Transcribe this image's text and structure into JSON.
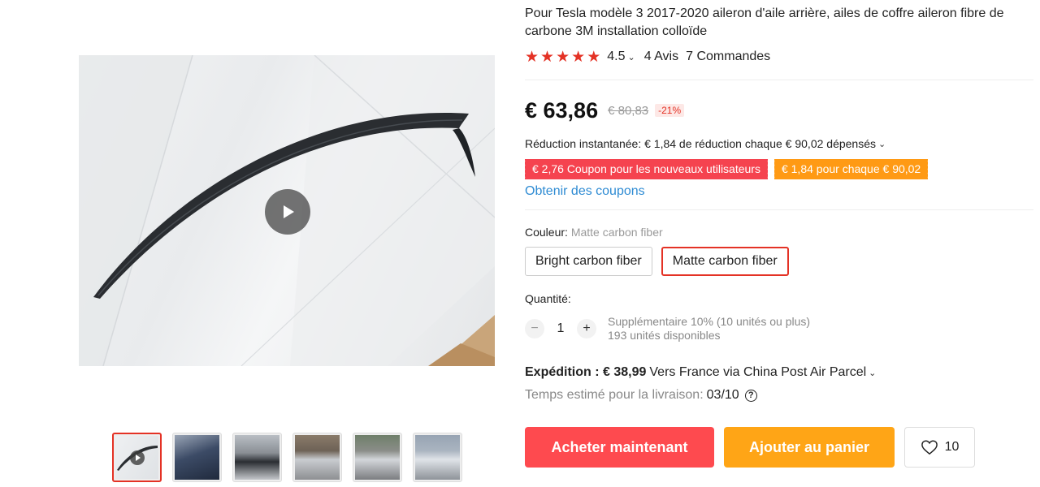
{
  "product": {
    "title": "Pour Tesla modèle 3 2017-2020 aileron d'aile arrière, ailes de coffre aileron fibre de carbone 3M installation colloïde",
    "rating": "4.5",
    "reviews": "4 Avis",
    "orders": "7 Commandes"
  },
  "price": {
    "current": "€ 63,86",
    "original": "€ 80,83",
    "discount": "-21%"
  },
  "promo": {
    "instant": "Réduction instantanée: € 1,84 de réduction chaque € 90,02 dépensés",
    "coupons": [
      "€ 2,76 Coupon pour les nouveaux utilisateurs",
      "€ 1,84 pour chaque € 90,02"
    ],
    "get_coupons": "Obtenir des coupons"
  },
  "color": {
    "label": "Couleur:",
    "selected": "Matte carbon fiber",
    "options": [
      "Bright carbon fiber",
      "Matte carbon fiber"
    ]
  },
  "quantity": {
    "label": "Quantité:",
    "value": "1",
    "minus": "−",
    "plus": "+",
    "extra": "Supplémentaire 10% (10 unités ou plus)",
    "available": "193 unités disponibles"
  },
  "shipping": {
    "label": "Expédition : € 38,99",
    "detail": "Vers France via China Post Air Parcel",
    "delivery_label": "Temps estimé pour la livraison:",
    "delivery_date": "03/10",
    "help": "?"
  },
  "actions": {
    "buy": "Acheter maintenant",
    "cart": "Ajouter au panier",
    "wishlist_count": "10"
  },
  "colors": {
    "accent_red": "#e43225",
    "buy_button": "#fe4a4f",
    "cart_button": "#ffa516",
    "coupon_red": "#f5434f",
    "coupon_orange": "#ff9a14",
    "link_blue": "#2e8bd3"
  },
  "icons": [
    "play-icon",
    "star-icon",
    "chevron-down-icon",
    "question-icon",
    "heart-icon"
  ]
}
